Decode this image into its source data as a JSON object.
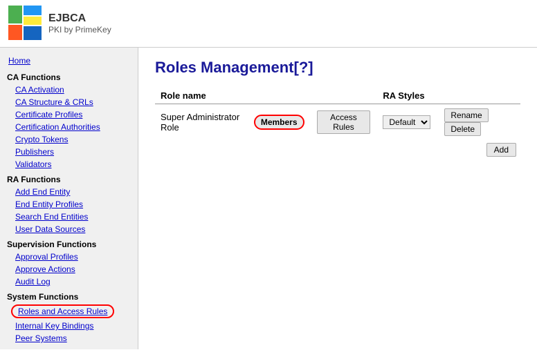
{
  "logo": {
    "title": "EJBCA",
    "subtitle": "PKI by PrimeKey"
  },
  "sidebar": {
    "home_label": "Home",
    "ca_functions_label": "CA Functions",
    "ra_functions_label": "RA Functions",
    "supervision_functions_label": "Supervision Functions",
    "system_functions_label": "System Functions",
    "ca_items": [
      {
        "label": "CA Activation",
        "id": "ca-activation"
      },
      {
        "label": "CA Structure & CRLs",
        "id": "ca-structure-crls"
      },
      {
        "label": "Certificate Profiles",
        "id": "certificate-profiles"
      },
      {
        "label": "Certification Authorities",
        "id": "certification-authorities"
      },
      {
        "label": "Crypto Tokens",
        "id": "crypto-tokens"
      },
      {
        "label": "Publishers",
        "id": "publishers"
      },
      {
        "label": "Validators",
        "id": "validators"
      }
    ],
    "ra_items": [
      {
        "label": "Add End Entity",
        "id": "add-end-entity"
      },
      {
        "label": "End Entity Profiles",
        "id": "end-entity-profiles"
      },
      {
        "label": "Search End Entities",
        "id": "search-end-entities"
      },
      {
        "label": "User Data Sources",
        "id": "user-data-sources"
      }
    ],
    "supervision_items": [
      {
        "label": "Approval Profiles",
        "id": "approval-profiles"
      },
      {
        "label": "Approve Actions",
        "id": "approve-actions"
      },
      {
        "label": "Audit Log",
        "id": "audit-log"
      }
    ],
    "system_items": [
      {
        "label": "Roles and Access Rules",
        "id": "roles-and-access-rules",
        "active": true
      },
      {
        "label": "Internal Key Bindings",
        "id": "internal-key-bindings"
      },
      {
        "label": "Peer Systems",
        "id": "peer-systems"
      }
    ]
  },
  "main": {
    "title": "Roles Management[?]",
    "col_role_name": "Role name",
    "col_ra_styles": "RA Styles",
    "row": {
      "role_name": "Super Administrator Role",
      "members_label": "Members",
      "access_rules_label": "Access Rules",
      "ra_select_options": [
        "Default"
      ],
      "ra_select_value": "Default",
      "rename_label": "Rename",
      "delete_label": "Delete"
    },
    "add_label": "Add"
  }
}
